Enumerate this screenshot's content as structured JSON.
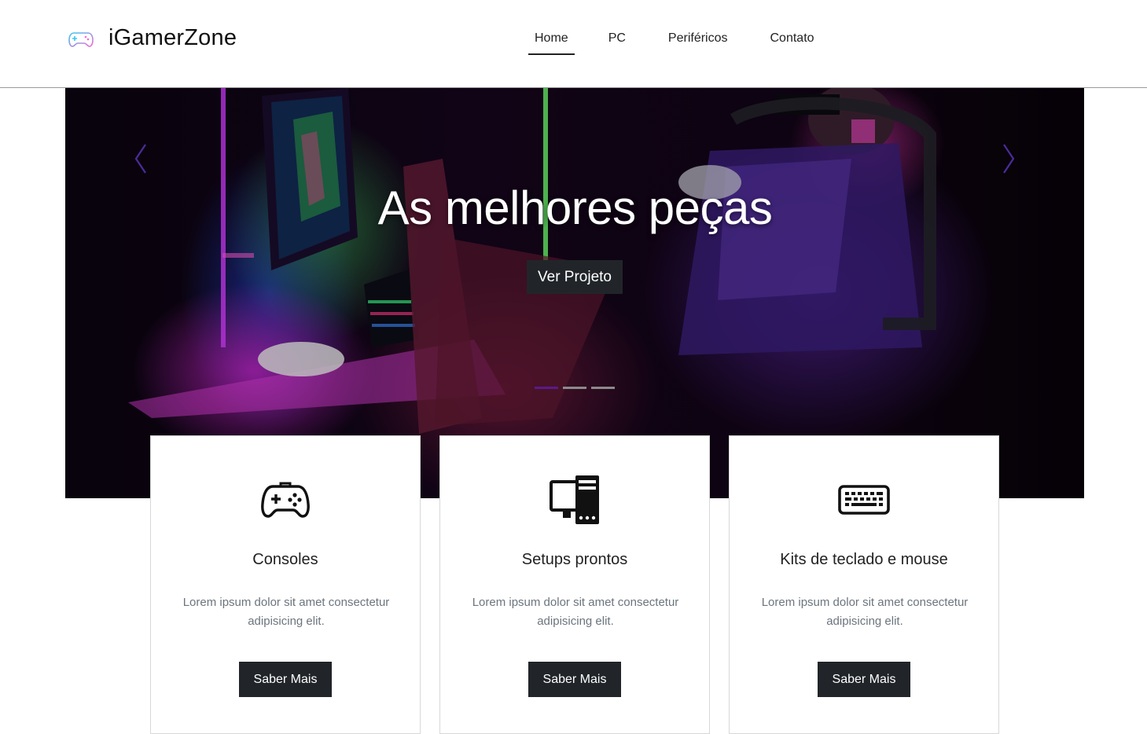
{
  "header": {
    "brand_icon": "gamepad-icon",
    "brand_name": "iGamerZone",
    "nav": [
      {
        "label": "Home",
        "active": true
      },
      {
        "label": "PC",
        "active": false
      },
      {
        "label": "Periféricos",
        "active": false
      },
      {
        "label": "Contato",
        "active": false
      }
    ]
  },
  "hero": {
    "title": "As melhores peças",
    "button_label": "Ver Projeto",
    "slides": 3,
    "active_slide": 1
  },
  "cards": [
    {
      "icon": "gamepad-icon",
      "title": "Consoles",
      "text": "Lorem ipsum dolor sit amet consectetur adipisicing elit.",
      "button_label": "Saber Mais"
    },
    {
      "icon": "desktop-tower-icon",
      "title": "Setups prontos",
      "text": "Lorem ipsum dolor sit amet consectetur adipisicing elit.",
      "button_label": "Saber Mais"
    },
    {
      "icon": "keyboard-icon",
      "title": "Kits de teclado e mouse",
      "text": "Lorem ipsum dolor sit amet consectetur adipisicing elit.",
      "button_label": "Saber Mais"
    }
  ],
  "colors": {
    "dark_button": "#212529",
    "indicator_active": "#5a1a8a",
    "accent_purple": "#6a2bd0"
  }
}
